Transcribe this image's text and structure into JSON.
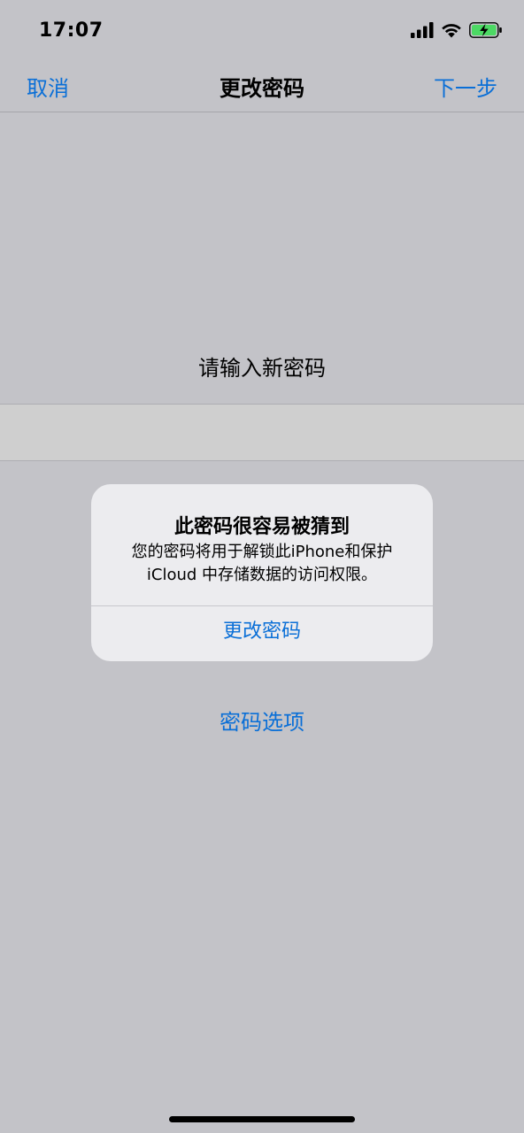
{
  "status_bar": {
    "time": "17:07",
    "icons": [
      "cellular-signal-icon",
      "wifi-icon",
      "battery-charging-icon"
    ],
    "battery_color": "#4cd964"
  },
  "nav": {
    "cancel_label": "取消",
    "title": "更改密码",
    "next_label": "下一步"
  },
  "prompt": "请输入新密码",
  "alert": {
    "title": "此密码很容易被猜到",
    "message_line1": "您的密码将用于解锁此iPhone和保护",
    "message_line2": "iCloud 中存储数据的访问权限。",
    "action_label": "更改密码"
  },
  "options_link": "密码选项",
  "colors": {
    "accent": "#0a6fd7",
    "background": "#c3c3c8",
    "alert_background": "#ececef"
  }
}
